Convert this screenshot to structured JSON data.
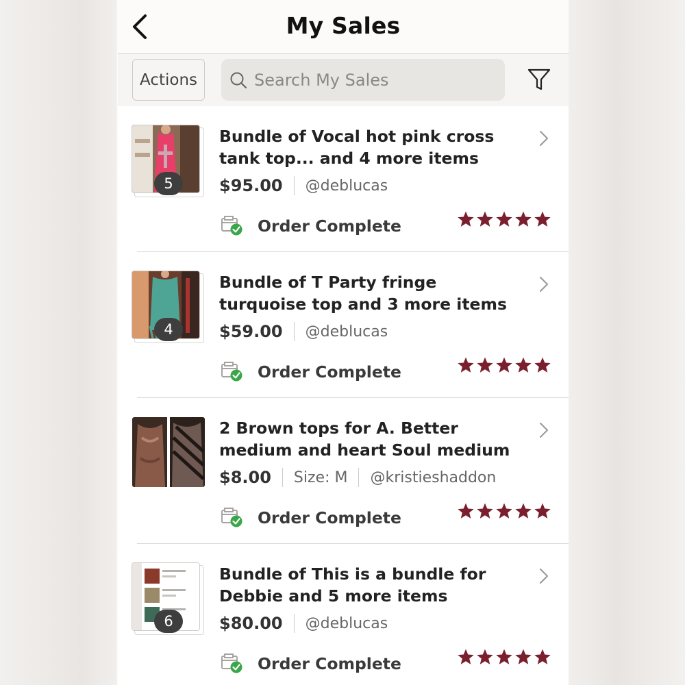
{
  "header": {
    "title": "My Sales"
  },
  "toolbar": {
    "actions_label": "Actions",
    "search_placeholder": "Search My Sales",
    "search_value": ""
  },
  "colors": {
    "star": "#7a1f2e",
    "check": "#3aa64a",
    "badge_bg": "#3e3e3e"
  },
  "sales": [
    {
      "title": "Bundle of Vocal hot pink cross tank top... and 4 more items",
      "price": "$95.00",
      "size": "",
      "buyer": "@deblucas",
      "count": "5",
      "status": "Order Complete",
      "rating": 5
    },
    {
      "title": "Bundle of T Party fringe turquoise top and 3 more items",
      "price": "$59.00",
      "size": "",
      "buyer": "@deblucas",
      "count": "4",
      "status": "Order Complete",
      "rating": 5
    },
    {
      "title": "2 Brown tops for A. Better medium and heart Soul medium",
      "price": "$8.00",
      "size": "Size: M",
      "buyer": "@kristieshaddon",
      "count": "",
      "status": "Order Complete",
      "rating": 5
    },
    {
      "title": "Bundle of This is a bundle for Debbie and 5 more items",
      "price": "$80.00",
      "size": "",
      "buyer": "@deblucas",
      "count": "6",
      "status": "Order Complete",
      "rating": 5
    }
  ]
}
